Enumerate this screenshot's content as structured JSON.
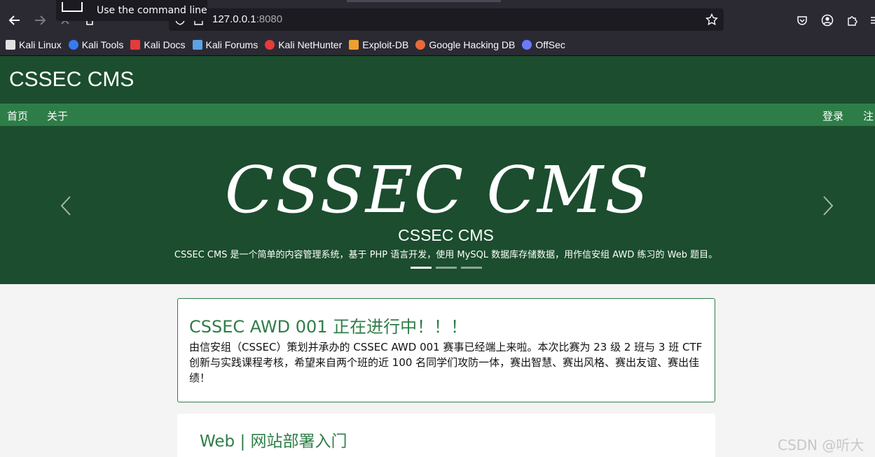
{
  "browser": {
    "tooltip": "Use the command line",
    "url_host": "127.0.0.1",
    "url_port": ":8080",
    "bookmarks": [
      {
        "label": "Kali Linux",
        "color": "#e2e2e2"
      },
      {
        "label": "Kali Tools",
        "color": "#367bf0"
      },
      {
        "label": "Kali Docs",
        "color": "#e53b3b"
      },
      {
        "label": "Kali Forums",
        "color": "#5aa3e6"
      },
      {
        "label": "Kali NetHunter",
        "color": "#e53b3b"
      },
      {
        "label": "Exploit-DB",
        "color": "#f0a030"
      },
      {
        "label": "Google Hacking DB",
        "color": "#e86a3a"
      },
      {
        "label": "OffSec",
        "color": "#6a7bff"
      }
    ]
  },
  "site": {
    "title": "CSSEC CMS",
    "nav": {
      "home": "首页",
      "about": "关于",
      "login": "登录",
      "register": "注"
    },
    "carousel": {
      "hero_text": "CSSEC CMS",
      "caption_title": "CSSEC CMS",
      "caption_text": "CSSEC CMS 是一个简单的内容管理系统，基于 PHP 语言开发，使用 MySQL 数据库存储数据，用作信安组 AWD 练习的 Web 题目。",
      "slide_count": 3,
      "active_slide": 1
    },
    "posts": [
      {
        "title": "CSSEC AWD 001 正在进行中！！！",
        "body": "由信安组（CSSEC）策划并承办的 CSSEC AWD 001 赛事已经端上来啦。本次比赛为 23 级 2 班与 3 班 CTF 创新与实践课程考核，希望来自两个班的近 100 名同学们攻防一体，赛出智慧、赛出风格、赛出友谊、赛出佳绩！"
      },
      {
        "title": "Web | 网站部署入门"
      }
    ],
    "watermark": "CSDN @听大"
  },
  "colors": {
    "header_bg": "#1b4d2e",
    "nav_bg": "#2e7d48",
    "accent": "#2e7d48"
  }
}
